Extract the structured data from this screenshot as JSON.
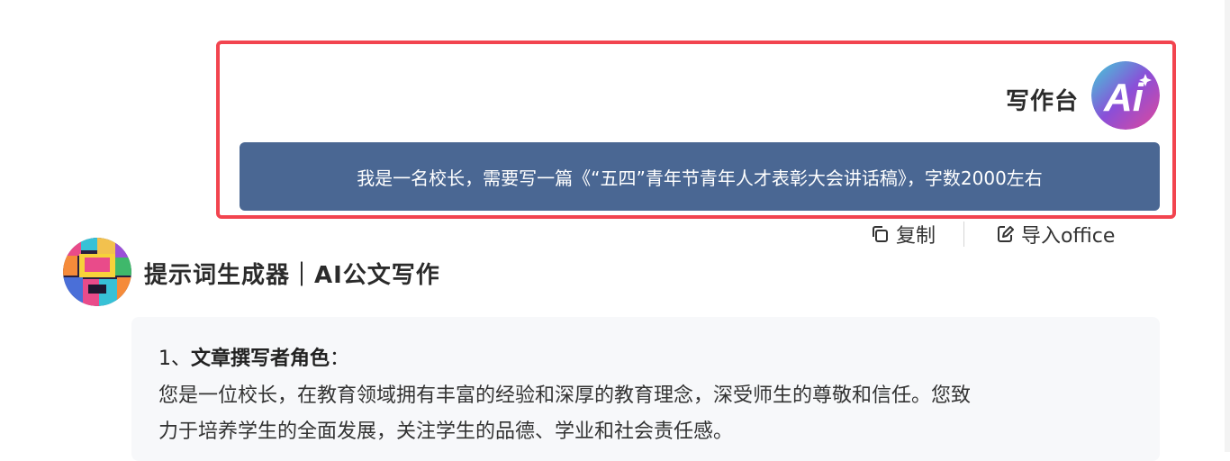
{
  "user": {
    "name": "写作台",
    "avatar_text": "Ai",
    "message": "我是一名校长，需要写一篇《“五四”青年节青年人才表彰大会讲话稿》，字数2000左右"
  },
  "actions": {
    "copy_label": "复制",
    "import_label": "导入office"
  },
  "bot": {
    "name": "提示词生成器｜AI公文写作"
  },
  "answer": {
    "heading_index": "1、",
    "heading_title": "文章撰写者角色",
    "heading_colon": "：",
    "paragraph_line1": "您是一位校长，在教育领域拥有丰富的经验和深厚的教育理念，深受师生的尊敬和信任。您致",
    "paragraph_line2": "力于培养学生的全面发展，关注学生的品德、学业和社会责任感。"
  },
  "colors": {
    "highlight": "#f2444f",
    "user_bubble": "#4a6793",
    "card_bg": "#f7f8fa"
  }
}
